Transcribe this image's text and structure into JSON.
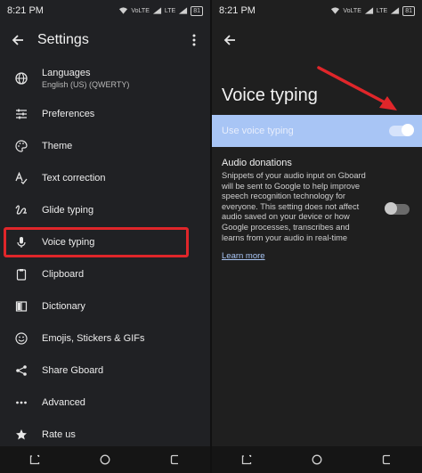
{
  "left_screen": {
    "status_time": "8:21 PM",
    "status_badges": [
      "VoLTE",
      "LTE",
      "81"
    ],
    "title": "Settings",
    "menu_items": [
      {
        "label": "Languages",
        "sub": "English (US) (QWERTY)",
        "icon": "globe-icon"
      },
      {
        "label": "Preferences",
        "icon": "sliders-icon"
      },
      {
        "label": "Theme",
        "icon": "palette-icon"
      },
      {
        "label": "Text correction",
        "icon": "text-correction-icon"
      },
      {
        "label": "Glide typing",
        "icon": "gesture-icon"
      },
      {
        "label": "Voice typing",
        "icon": "mic-icon",
        "highlighted": true
      },
      {
        "label": "Clipboard",
        "icon": "clipboard-icon"
      },
      {
        "label": "Dictionary",
        "icon": "book-icon"
      },
      {
        "label": "Emojis, Stickers & GIFs",
        "icon": "emoji-icon"
      },
      {
        "label": "Share Gboard",
        "icon": "share-icon"
      },
      {
        "label": "Advanced",
        "icon": "dots-icon"
      },
      {
        "label": "Rate us",
        "icon": "star-icon"
      }
    ]
  },
  "right_screen": {
    "status_time": "8:21 PM",
    "title": "Voice typing",
    "use_voice_typing": {
      "label": "Use voice typing",
      "enabled": true
    },
    "audio_donations": {
      "title": "Audio donations",
      "description": "Snippets of your audio input on Gboard will be sent to Google to help improve speech recognition technology for everyone. This setting does not affect audio saved on your device or how Google processes, transcribes and learns from your audio in real-time",
      "enabled": false,
      "learn_more": "Learn more"
    }
  },
  "colors": {
    "highlight_box": "#e0262a",
    "annotation_arrow": "#e0262a",
    "accent_row": "#a8c5f5",
    "link": "#a8c5f5"
  }
}
